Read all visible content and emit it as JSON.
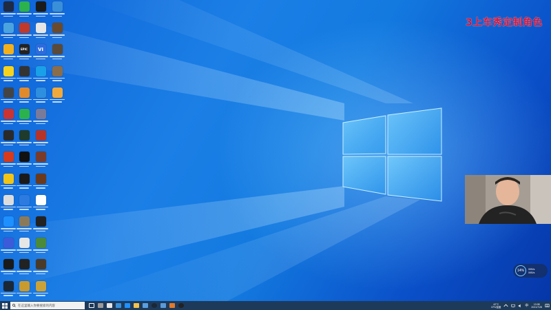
{
  "overlay": {
    "text": "3上车秀定制角色"
  },
  "desktop_icons": [
    {
      "col": 0,
      "row": 0,
      "color": "#1f2a44",
      "glyph": "",
      "icon": "pc-icon"
    },
    {
      "col": 1,
      "row": 0,
      "color": "#2bb24c",
      "glyph": "",
      "icon": "wechat-icon"
    },
    {
      "col": 2,
      "row": 0,
      "color": "#1b1b1b",
      "glyph": "",
      "icon": "app-icon"
    },
    {
      "col": 3,
      "row": 0,
      "color": "#3a8fd9",
      "glyph": "",
      "icon": "network-icon"
    },
    {
      "col": 0,
      "row": 1,
      "color": "#4aa3df",
      "glyph": "",
      "icon": "laptop-icon"
    },
    {
      "col": 1,
      "row": 1,
      "color": "#c0392b",
      "glyph": "",
      "icon": "target-icon"
    },
    {
      "col": 2,
      "row": 1,
      "color": "#e6e6e6",
      "glyph": "",
      "icon": "document-icon"
    },
    {
      "col": 3,
      "row": 1,
      "color": "#6b4a2b",
      "glyph": "",
      "icon": "game-icon"
    },
    {
      "col": 0,
      "row": 2,
      "color": "#f2b01e",
      "glyph": "",
      "icon": "app-icon"
    },
    {
      "col": 1,
      "row": 2,
      "color": "#222222",
      "glyph": "EPIC",
      "icon": "epic-games-icon"
    },
    {
      "col": 2,
      "row": 2,
      "color": "#2d6cdf",
      "glyph": "VI",
      "icon": "vi-icon"
    },
    {
      "col": 3,
      "row": 2,
      "color": "#5a4a3a",
      "glyph": "",
      "icon": "game-icon"
    },
    {
      "col": 0,
      "row": 3,
      "color": "#f4d21f",
      "glyph": "",
      "icon": "app-icon"
    },
    {
      "col": 1,
      "row": 3,
      "color": "#333333",
      "glyph": "",
      "icon": "game-icon"
    },
    {
      "col": 2,
      "row": 3,
      "color": "#1aa0e8",
      "glyph": "",
      "icon": "qq-icon"
    },
    {
      "col": 3,
      "row": 3,
      "color": "#8a6d4b",
      "glyph": "",
      "icon": "game-icon"
    },
    {
      "col": 0,
      "row": 4,
      "color": "#444444",
      "glyph": "",
      "icon": "game-icon"
    },
    {
      "col": 1,
      "row": 4,
      "color": "#e08a2c",
      "glyph": "",
      "icon": "app-icon"
    },
    {
      "col": 2,
      "row": 4,
      "color": "#2e8fe0",
      "glyph": "",
      "icon": "cloud-icon"
    },
    {
      "col": 3,
      "row": 4,
      "color": "#f2a93b",
      "glyph": "",
      "icon": "app-icon"
    },
    {
      "col": 0,
      "row": 5,
      "color": "#cc3333",
      "glyph": "",
      "icon": "app-icon"
    },
    {
      "col": 1,
      "row": 5,
      "color": "#2bb24c",
      "glyph": "",
      "icon": "check-icon"
    },
    {
      "col": 2,
      "row": 5,
      "color": "#7a7a9a",
      "glyph": "",
      "icon": "app-icon"
    },
    {
      "col": 0,
      "row": 6,
      "color": "#2a2a2a",
      "glyph": "",
      "icon": "game-icon"
    },
    {
      "col": 1,
      "row": 6,
      "color": "#1f3b2b",
      "glyph": "",
      "icon": "game-icon"
    },
    {
      "col": 2,
      "row": 6,
      "color": "#b5342a",
      "glyph": "",
      "icon": "app-icon"
    },
    {
      "col": 0,
      "row": 7,
      "color": "#d83a1c",
      "glyph": "",
      "icon": "app-icon"
    },
    {
      "col": 1,
      "row": 7,
      "color": "#111111",
      "glyph": "",
      "icon": "game-icon"
    },
    {
      "col": 2,
      "row": 7,
      "color": "#7a3b2a",
      "glyph": "",
      "icon": "game-icon"
    },
    {
      "col": 0,
      "row": 8,
      "color": "#f0c419",
      "glyph": "",
      "icon": "app-icon"
    },
    {
      "col": 1,
      "row": 8,
      "color": "#1a1a1a",
      "glyph": "",
      "icon": "game-icon"
    },
    {
      "col": 2,
      "row": 8,
      "color": "#6b3a1c",
      "glyph": "",
      "icon": "game-icon"
    },
    {
      "col": 0,
      "row": 9,
      "color": "#dcdcdc",
      "glyph": "",
      "icon": "recycle-bin-icon"
    },
    {
      "col": 1,
      "row": 9,
      "color": "#2d7be0",
      "glyph": "",
      "icon": "app-icon"
    },
    {
      "col": 2,
      "row": 9,
      "color": "#ffffff",
      "glyph": "",
      "icon": "app-icon"
    },
    {
      "col": 0,
      "row": 10,
      "color": "#1e90ff",
      "glyph": "",
      "icon": "edge-icon"
    },
    {
      "col": 1,
      "row": 10,
      "color": "#8a7a5a",
      "glyph": "",
      "icon": "app-icon"
    },
    {
      "col": 2,
      "row": 10,
      "color": "#222222",
      "glyph": "",
      "icon": "app-icon"
    },
    {
      "col": 0,
      "row": 11,
      "color": "#3b5bdb",
      "glyph": "",
      "icon": "app-icon"
    },
    {
      "col": 1,
      "row": 11,
      "color": "#e6e6e6",
      "glyph": "",
      "icon": "document-icon"
    },
    {
      "col": 2,
      "row": 11,
      "color": "#4a8a3a",
      "glyph": "",
      "icon": "minecraft-icon"
    },
    {
      "col": 0,
      "row": 12,
      "color": "#1a1a1a",
      "glyph": "",
      "icon": "nvidia-icon"
    },
    {
      "col": 1,
      "row": 12,
      "color": "#222222",
      "glyph": "",
      "icon": "record-icon"
    },
    {
      "col": 2,
      "row": 12,
      "color": "#4a3a2a",
      "glyph": "",
      "icon": "game-icon"
    },
    {
      "col": 0,
      "row": 13,
      "color": "#1b2838",
      "glyph": "",
      "icon": "steam-icon"
    },
    {
      "col": 1,
      "row": 13,
      "color": "#c99a2e",
      "glyph": "",
      "icon": "app-icon"
    },
    {
      "col": 2,
      "row": 13,
      "color": "#caa23a",
      "glyph": "",
      "icon": "game-icon"
    }
  ],
  "network_widget": {
    "percent": "14%",
    "up": "0KB/s",
    "down": "0KB/s"
  },
  "taskbar": {
    "search_placeholder": "在这里输入你要搜索的内容",
    "apps": [
      {
        "icon": "task-view-icon",
        "color": "#ffffff"
      },
      {
        "icon": "calculator-icon",
        "color": "#9a9a9a"
      },
      {
        "icon": "app-icon",
        "color": "#e6e6e6"
      },
      {
        "icon": "store-icon",
        "color": "#3a8fd9"
      },
      {
        "icon": "edge-icon",
        "color": "#1e90ff"
      },
      {
        "icon": "folder-icon",
        "color": "#f2c14e"
      },
      {
        "icon": "window-icon",
        "color": "#5aa0e0"
      },
      {
        "icon": "steam-icon",
        "color": "#1b2838"
      },
      {
        "icon": "app-icon",
        "color": "#5a9ad8"
      },
      {
        "icon": "app-icon",
        "color": "#e07a2c"
      },
      {
        "icon": "obs-icon",
        "color": "#222222"
      }
    ],
    "tray": {
      "temp": "42°C",
      "temp_label": "CPU温度",
      "lang": "中",
      "time": "13:08",
      "date": "2021/7/28"
    }
  }
}
